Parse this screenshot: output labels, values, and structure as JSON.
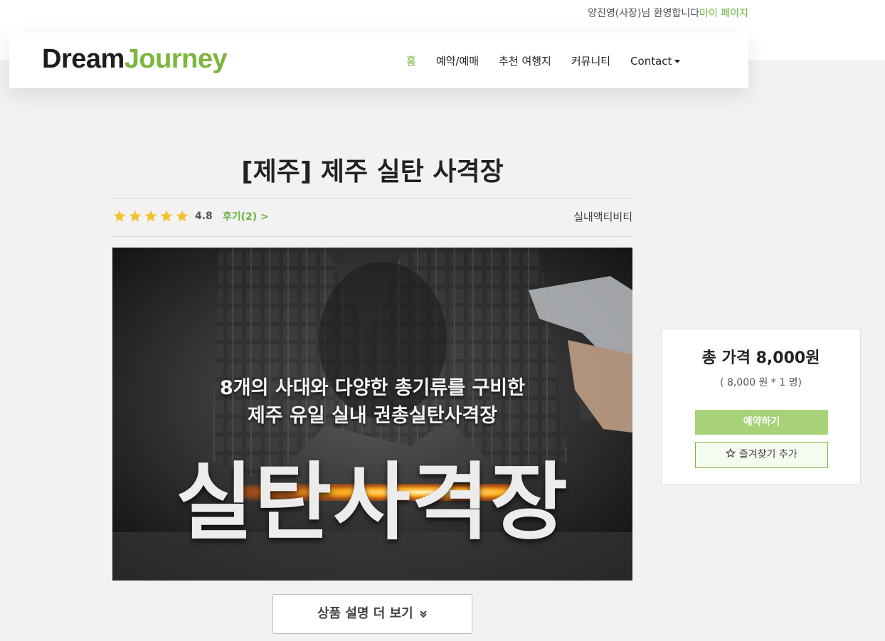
{
  "topbar": {
    "welcome": "양진영(사장)님 환영합니다",
    "mypage": "마이 페이지"
  },
  "brand": {
    "part1": "Dream",
    "part2": "Journey",
    "accent_color": "#7cb73d"
  },
  "nav": {
    "items": [
      {
        "label": "홈",
        "active": true
      },
      {
        "label": "예약/예매",
        "active": false
      },
      {
        "label": "추천 여행지",
        "active": false
      },
      {
        "label": "커뮤니티",
        "active": false
      },
      {
        "label": "Contact",
        "active": false,
        "dropdown": true
      }
    ]
  },
  "product": {
    "title": "[제주] 제주 실탄 사격장",
    "rating": {
      "stars": 5,
      "score": "4.8",
      "reviews_label": "후기(2) >"
    },
    "category": "실내액티비티",
    "image": {
      "subtitle_line1": "8개의 사대와 다양한 총기류를 구비한",
      "subtitle_line2": "제주 유일 실내 권총실탄사격장",
      "headline": "실탄사격장"
    },
    "more_button": "상품 설명 더 보기"
  },
  "price": {
    "total": "총 가격 8,000원",
    "detail": "( 8,000 원 * 1 명)",
    "book_button": "예약하기",
    "favorite_button": "즐겨찾기 추가"
  },
  "icons": {
    "star": "star-icon",
    "chevron": "double-chevron-down-icon",
    "favorite": "star-outline-icon"
  }
}
